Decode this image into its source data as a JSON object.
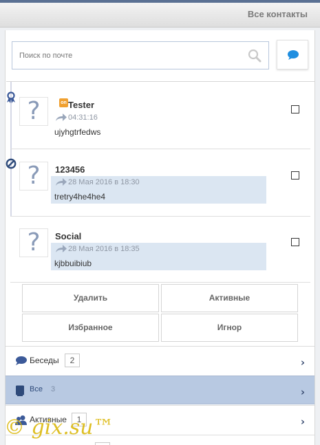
{
  "header": {
    "title": "Все контакты"
  },
  "search": {
    "placeholder": "Поиск по почте"
  },
  "contacts": [
    {
      "name": "Tester",
      "time": "04:31:16",
      "text": "ujyhgtrfedws",
      "status_badge": "on"
    },
    {
      "name": "123456",
      "time": "28 Мая 2016 в 18:30",
      "text": "tretry4he4he4"
    },
    {
      "name": "Social",
      "time": "28 Мая 2016 в 18:35",
      "text": "kjbbuibiub"
    }
  ],
  "avatar_placeholder": "?",
  "actions": {
    "delete": "Удалить",
    "active": "Активные",
    "favorites": "Избранное",
    "ignore": "Игнор"
  },
  "nav": [
    {
      "label": "Беседы",
      "count": "2"
    },
    {
      "label": "Все",
      "count": "3"
    },
    {
      "label": "Активные",
      "count": "1"
    },
    {
      "label": "",
      "count": ""
    }
  ],
  "watermark": "© gix.su™",
  "colors": {
    "accent": "#5a7093",
    "highlight": "#dbe6f2",
    "active_row": "#b8c9e2",
    "icon_blue": "#3c5a99",
    "chat_icon": "#1f8ee0"
  }
}
